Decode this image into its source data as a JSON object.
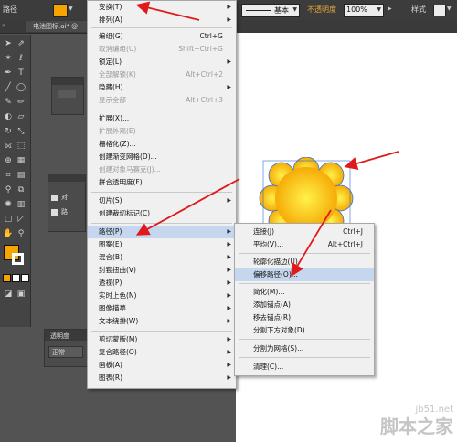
{
  "topbar": {
    "path_label": "路径",
    "stroke_style": "基本",
    "opacity_label": "不透明度",
    "opacity_value": "100%",
    "style_label": "样式"
  },
  "document_tab": {
    "title": "电池图标.ai* @"
  },
  "panels": {
    "transparency_title": "透明度",
    "blend_mode": "正常",
    "side_labels": [
      "对",
      "路"
    ]
  },
  "colors": {
    "fill": "#f5a400",
    "accent_red": "#e0191b",
    "menu_highlight": "#c5d7ef"
  },
  "object_menu": {
    "items": [
      {
        "label": "变换(T)",
        "shortcut": "",
        "submenu": true,
        "disabled": false
      },
      {
        "label": "排列(A)",
        "shortcut": "",
        "submenu": true,
        "disabled": false
      },
      {
        "label": "编组(G)",
        "shortcut": "Ctrl+G",
        "submenu": false,
        "disabled": false
      },
      {
        "label": "取消编组(U)",
        "shortcut": "Shift+Ctrl+G",
        "submenu": false,
        "disabled": true
      },
      {
        "label": "锁定(L)",
        "shortcut": "",
        "submenu": true,
        "disabled": false
      },
      {
        "label": "全部解锁(K)",
        "shortcut": "Alt+Ctrl+2",
        "submenu": false,
        "disabled": true
      },
      {
        "label": "隐藏(H)",
        "shortcut": "",
        "submenu": true,
        "disabled": false
      },
      {
        "label": "显示全部",
        "shortcut": "Alt+Ctrl+3",
        "submenu": false,
        "disabled": true
      },
      {
        "label": "扩展(X)...",
        "shortcut": "",
        "submenu": false,
        "disabled": false
      },
      {
        "label": "扩展外观(E)",
        "shortcut": "",
        "submenu": false,
        "disabled": true
      },
      {
        "label": "栅格化(Z)...",
        "shortcut": "",
        "submenu": false,
        "disabled": false
      },
      {
        "label": "创建渐变网格(D)...",
        "shortcut": "",
        "submenu": false,
        "disabled": false
      },
      {
        "label": "创建对象马赛克(J)...",
        "shortcut": "",
        "submenu": false,
        "disabled": true
      },
      {
        "label": "拼合透明度(F)...",
        "shortcut": "",
        "submenu": false,
        "disabled": false
      },
      {
        "label": "切片(S)",
        "shortcut": "",
        "submenu": true,
        "disabled": false
      },
      {
        "label": "创建裁切标记(C)",
        "shortcut": "",
        "submenu": false,
        "disabled": false
      },
      {
        "label": "路径(P)",
        "shortcut": "",
        "submenu": true,
        "disabled": false
      },
      {
        "label": "图案(E)",
        "shortcut": "",
        "submenu": true,
        "disabled": false
      },
      {
        "label": "混合(B)",
        "shortcut": "",
        "submenu": true,
        "disabled": false
      },
      {
        "label": "封套扭曲(V)",
        "shortcut": "",
        "submenu": true,
        "disabled": false
      },
      {
        "label": "透视(P)",
        "shortcut": "",
        "submenu": true,
        "disabled": false
      },
      {
        "label": "实时上色(N)",
        "shortcut": "",
        "submenu": true,
        "disabled": false
      },
      {
        "label": "图像描摹",
        "shortcut": "",
        "submenu": true,
        "disabled": false
      },
      {
        "label": "文本绕排(W)",
        "shortcut": "",
        "submenu": true,
        "disabled": false
      },
      {
        "label": "剪切蒙版(M)",
        "shortcut": "",
        "submenu": true,
        "disabled": false
      },
      {
        "label": "复合路径(O)",
        "shortcut": "",
        "submenu": true,
        "disabled": false
      },
      {
        "label": "画板(A)",
        "shortcut": "",
        "submenu": true,
        "disabled": false
      },
      {
        "label": "图表(R)",
        "shortcut": "",
        "submenu": true,
        "disabled": false
      }
    ]
  },
  "path_submenu": {
    "items": [
      {
        "label": "连接(J)",
        "shortcut": "Ctrl+J"
      },
      {
        "label": "平均(V)...",
        "shortcut": "Alt+Ctrl+J"
      },
      {
        "label": "轮廓化描边(U)",
        "shortcut": ""
      },
      {
        "label": "偏移路径(O)...",
        "shortcut": ""
      },
      {
        "label": "简化(M)...",
        "shortcut": ""
      },
      {
        "label": "添加锚点(A)",
        "shortcut": ""
      },
      {
        "label": "移去锚点(R)",
        "shortcut": ""
      },
      {
        "label": "分割下方对象(D)",
        "shortcut": ""
      },
      {
        "label": "分割为网格(S)...",
        "shortcut": ""
      },
      {
        "label": "清理(C)...",
        "shortcut": ""
      }
    ]
  },
  "watermark": {
    "line1": "jb51.net",
    "line2": "脚本之家"
  }
}
